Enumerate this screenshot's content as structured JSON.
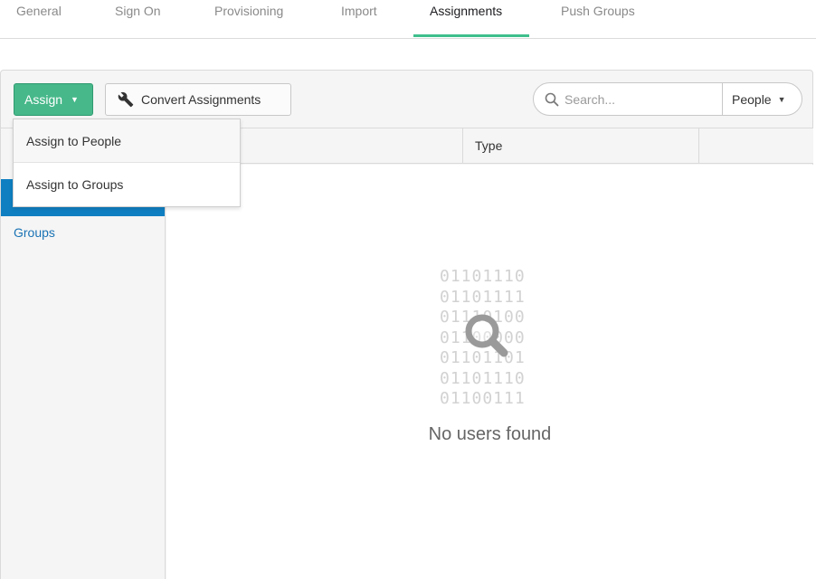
{
  "tabs": [
    {
      "label": "General"
    },
    {
      "label": "Sign On"
    },
    {
      "label": "Provisioning"
    },
    {
      "label": "Import"
    },
    {
      "label": "Assignments",
      "active": true
    },
    {
      "label": "Push Groups"
    }
  ],
  "toolbar": {
    "assign_label": "Assign",
    "convert_label": "Convert Assignments",
    "search_placeholder": "Search...",
    "search_scope": "People"
  },
  "assign_menu": {
    "items": [
      {
        "label": "Assign to People"
      },
      {
        "label": "Assign to Groups"
      }
    ]
  },
  "table": {
    "columns": [
      {
        "label": "Type"
      }
    ]
  },
  "sidebar": {
    "items": [
      {
        "label": "Groups"
      }
    ]
  },
  "empty_state": {
    "binary_lines": [
      "01101110",
      "01101111",
      "01110100",
      "01100000",
      "01101101",
      "01101110",
      "01100111"
    ],
    "message": "No users found"
  },
  "colors": {
    "accent_green": "#47b88a",
    "tab_underline": "#3fbf8c",
    "sidebar_active": "#0f7fc2",
    "link_blue": "#1a73b5"
  },
  "icons": {
    "convert": "wrench-icon",
    "search": "search-icon",
    "empty_state": "magnifier-icon"
  }
}
